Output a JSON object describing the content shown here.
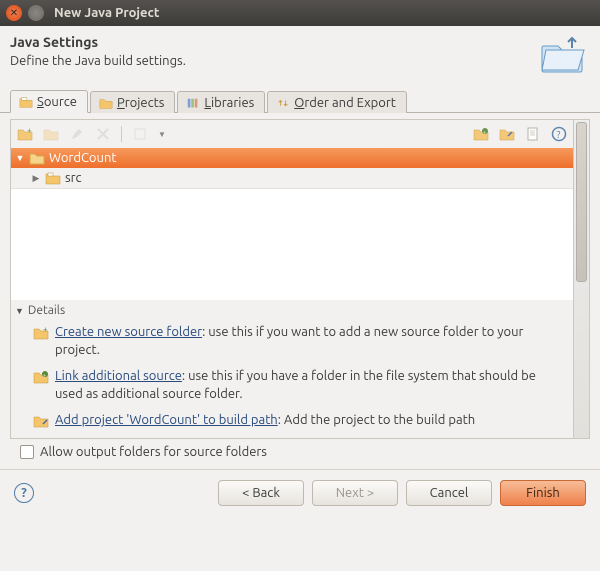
{
  "window": {
    "title": "New Java Project"
  },
  "header": {
    "title": "Java Settings",
    "subtitle": "Define the Java build settings."
  },
  "tabs": [
    {
      "label": "Source",
      "mnemonic": "S",
      "active": true
    },
    {
      "label": "Projects",
      "mnemonic": "P",
      "active": false
    },
    {
      "label": "Libraries",
      "mnemonic": "L",
      "active": false
    },
    {
      "label": "Order and Export",
      "mnemonic": "O",
      "active": false
    }
  ],
  "tree": {
    "root": {
      "label": "WordCount",
      "expanded": true,
      "selected": true
    },
    "children": [
      {
        "label": "src",
        "expanded": false
      }
    ]
  },
  "details": {
    "header": "Details",
    "items": [
      {
        "link": "Create new source folder",
        "rest": ": use this if you want to add a new source folder to your project."
      },
      {
        "link": "Link additional source",
        "rest": ": use this if you have a folder in the file system that should be used as additional source folder."
      },
      {
        "link": "Add project 'WordCount' to build path",
        "rest": ": Add the project to the build path"
      }
    ]
  },
  "allow_checkbox": {
    "label": "Allow output folders for source folders",
    "checked": false
  },
  "footer": {
    "back": "< Back",
    "next": "Next >",
    "cancel": "Cancel",
    "finish": "Finish"
  },
  "colors": {
    "selection": "#ee6f2d",
    "link": "#2a4c7d"
  }
}
